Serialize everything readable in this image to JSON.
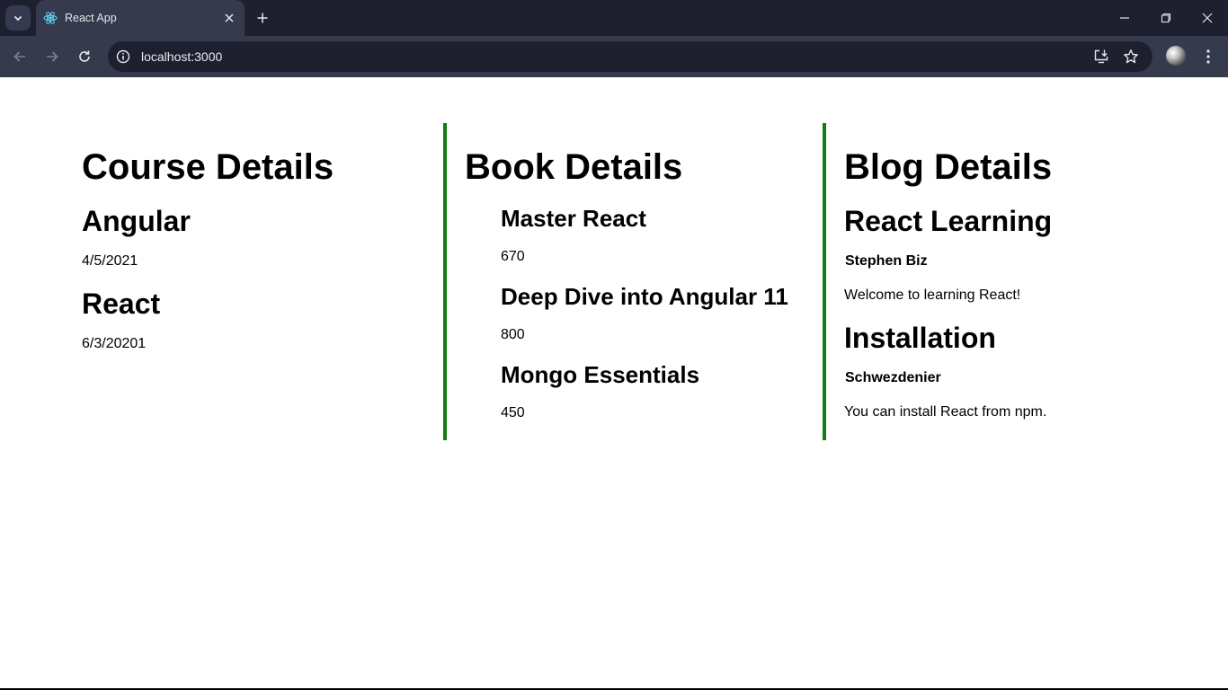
{
  "browser": {
    "tab_title": "React App",
    "url": "localhost:3000",
    "icons": {
      "tab_search": "chevron-down-icon",
      "favicon": "react-logo-icon",
      "tab_close": "close-icon",
      "new_tab": "plus-icon",
      "minimize": "minimize-icon",
      "restore": "restore-icon",
      "close_window": "close-icon",
      "back": "arrow-left-icon",
      "forward": "arrow-right-icon",
      "reload": "reload-icon",
      "site_info": "info-icon",
      "install": "install-app-icon",
      "bookmark": "star-icon",
      "profile": "avatar",
      "menu": "kebab-menu-icon"
    }
  },
  "courses": {
    "heading": "Course Details",
    "items": [
      {
        "name": "Angular",
        "date": "4/5/2021"
      },
      {
        "name": "React",
        "date": "6/3/20201"
      }
    ]
  },
  "books": {
    "heading": "Book Details",
    "items": [
      {
        "name": "Master React",
        "price": "670"
      },
      {
        "name": "Deep Dive into Angular 11",
        "price": "800"
      },
      {
        "name": "Mongo Essentials",
        "price": "450"
      }
    ]
  },
  "blogs": {
    "heading": "Blog Details",
    "items": [
      {
        "title": "React Learning",
        "author": "Stephen Biz",
        "content": "Welcome to learning React!"
      },
      {
        "title": "Installation",
        "author": "Schwezdenier",
        "content": "You can install React from npm."
      }
    ]
  },
  "colors": {
    "divider": "#117a11",
    "chrome_dark": "#1e2030",
    "chrome_light": "#353a4d"
  }
}
